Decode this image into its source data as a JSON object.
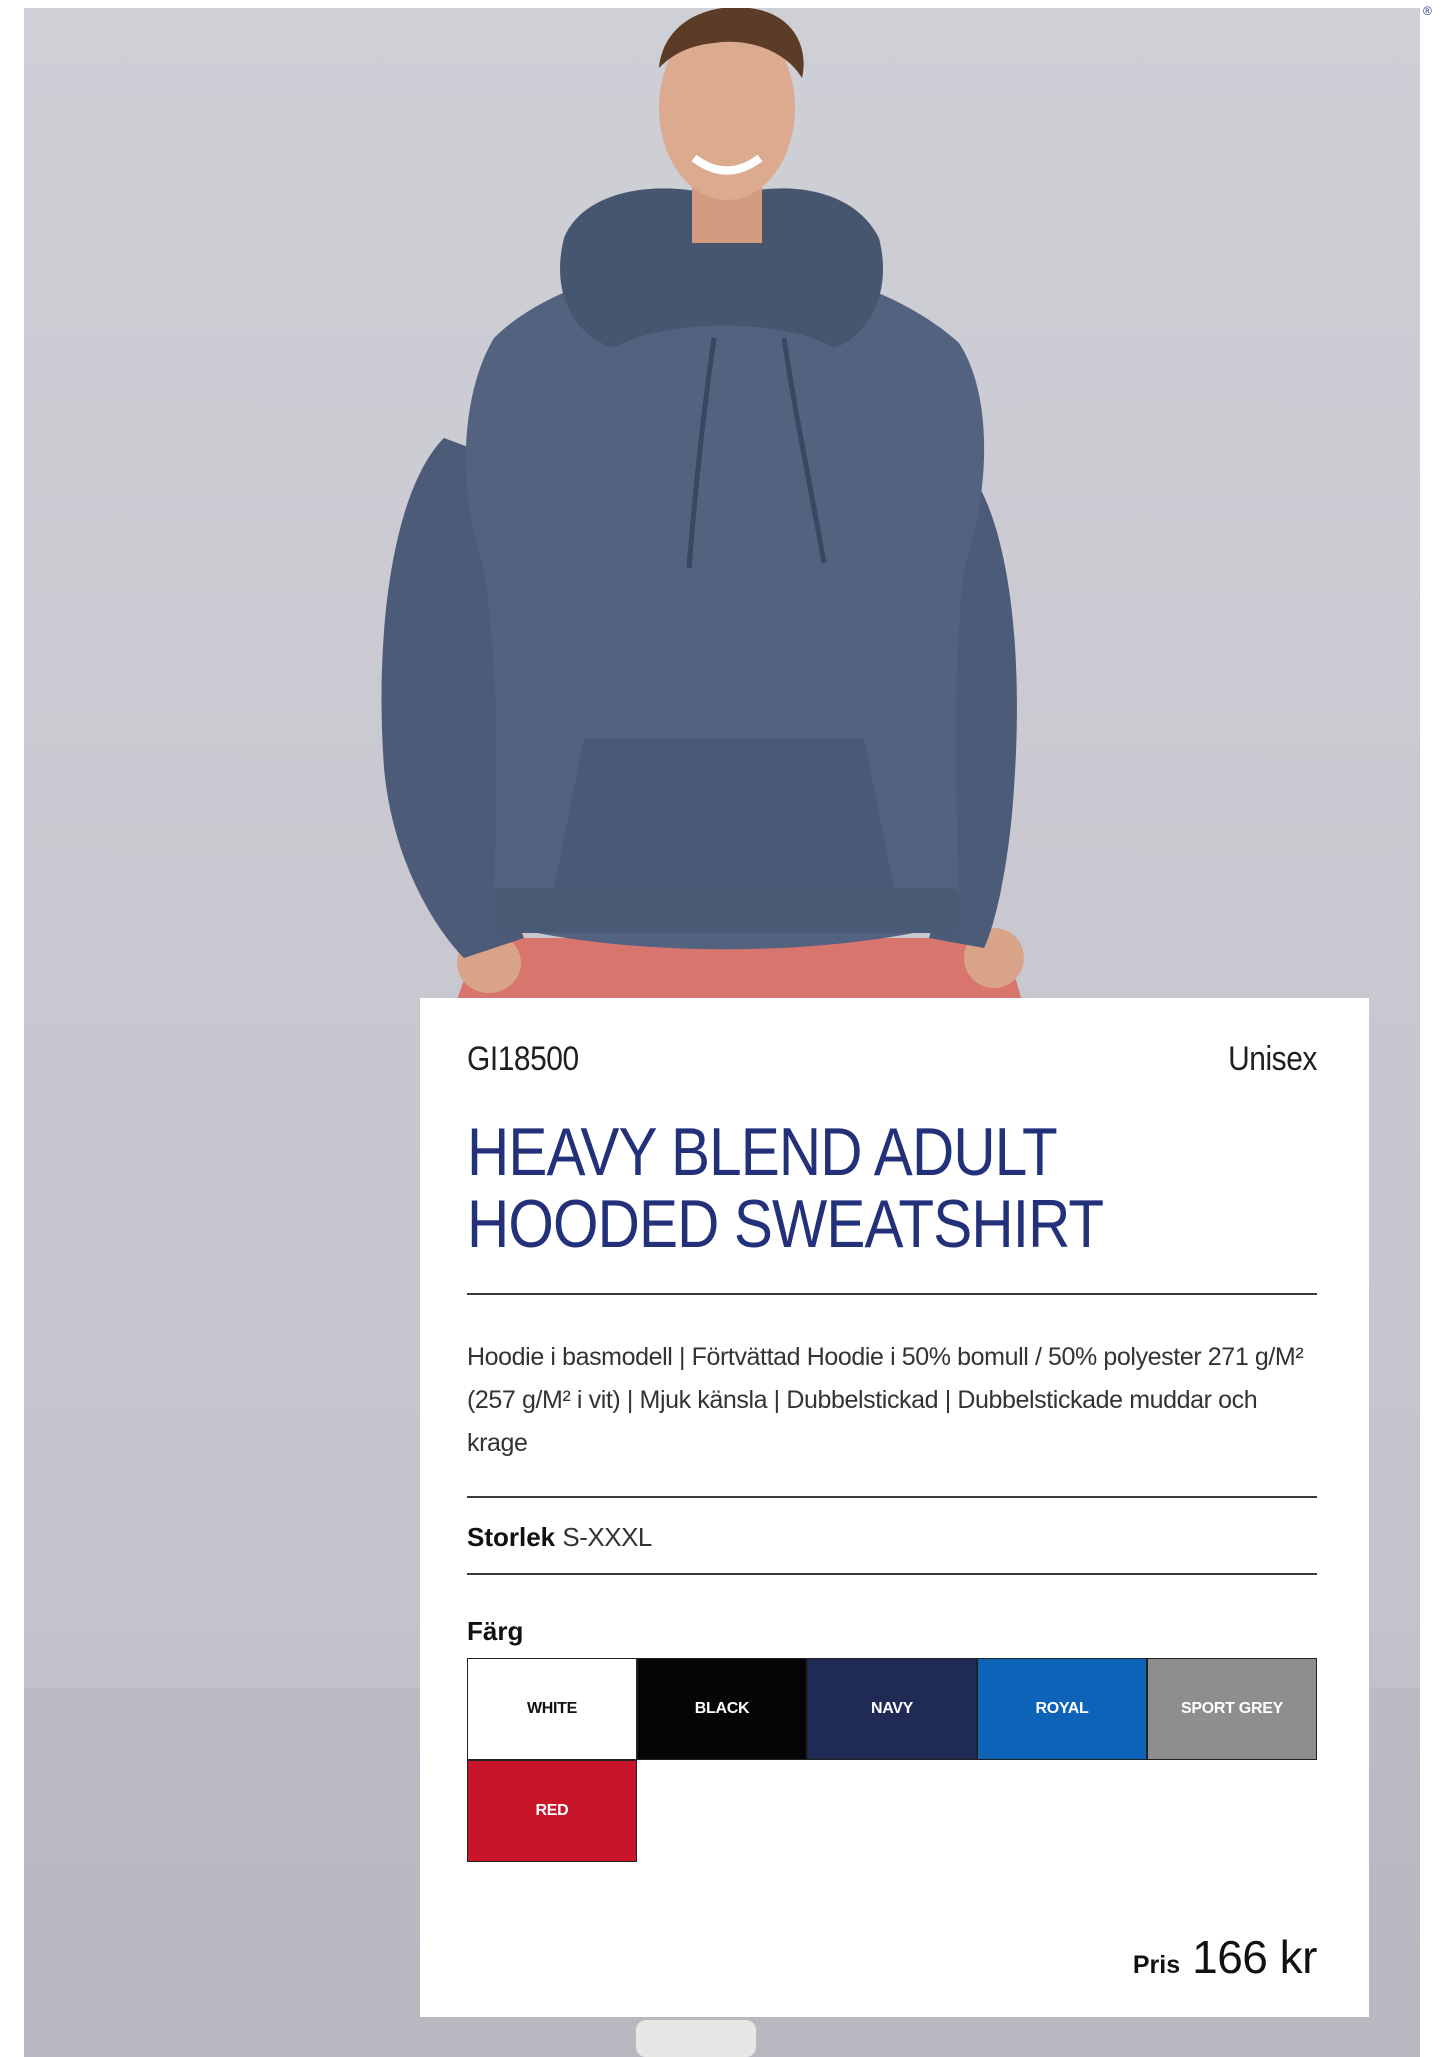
{
  "brand": {
    "registered_mark": "®"
  },
  "product": {
    "code": "GI18500",
    "gender": "Unisex",
    "title": "HEAVY BLEND ADULT HOODED SWEATSHIRT",
    "description": "Hoodie i basmodell | Förtvättad Hoodie i 50% bomull / 50% polyester 271 g/M² (257 g/M² i vit) | Mjuk känsla | Dubbelstickad | Dubbelstickade muddar och krage",
    "size_label": "Storlek",
    "size_value": "S-XXXL",
    "color_label": "Färg",
    "colors": [
      {
        "name": "WHITE",
        "bg": "#ffffff",
        "fg": "#111111"
      },
      {
        "name": "BLACK",
        "bg": "#050505",
        "fg": "#ffffff"
      },
      {
        "name": "NAVY",
        "bg": "#1f2a55",
        "fg": "#ffffff"
      },
      {
        "name": "ROYAL",
        "bg": "#0d63b8",
        "fg": "#ffffff"
      },
      {
        "name": "SPORT GREY",
        "bg": "#8e8e90",
        "fg": "#ffffff"
      },
      {
        "name": "RED",
        "bg": "#c8152a",
        "fg": "#ffffff"
      }
    ],
    "price_label": "Pris",
    "price_value": "166 kr"
  }
}
